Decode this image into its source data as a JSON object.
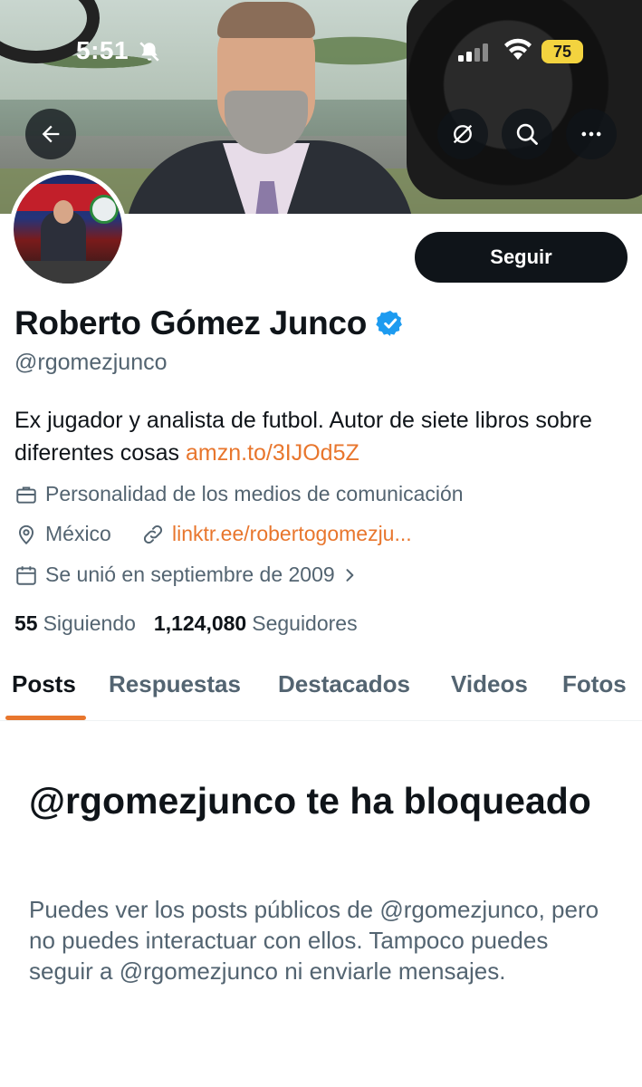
{
  "status_bar": {
    "time": "5:51",
    "battery": "75",
    "icons": [
      "bell-slash-icon",
      "signal-icon",
      "wifi-icon",
      "battery-icon"
    ]
  },
  "header": {
    "buttons": [
      "back-arrow-icon",
      "grok-icon",
      "search-icon",
      "more-icon"
    ]
  },
  "profile": {
    "name": "Roberto Gómez Junco",
    "handle": "@rgomezjunco",
    "follow_label": "Seguir",
    "bio_text": "Ex jugador y analista de futbol. Autor de siete libros sobre diferentes cosas ",
    "bio_link": "amzn.to/3IJOd5Z",
    "category": "Personalidad de los medios de comunicación",
    "location": "México",
    "website": "linktr.ee/robertogomezju...",
    "joined": "Se unió en septiembre de 2009",
    "following_count": "55",
    "following_label": "Siguiendo",
    "followers_count": "1,124,080",
    "followers_label": "Seguidores"
  },
  "tabs": [
    {
      "label": "Posts",
      "active": true
    },
    {
      "label": "Respuestas",
      "active": false
    },
    {
      "label": "Destacados",
      "active": false
    },
    {
      "label": "Videos",
      "active": false
    },
    {
      "label": "Fotos",
      "active": false
    }
  ],
  "blocked": {
    "title": "@rgomezjunco te ha bloqueado",
    "message": "Puedes ver los posts públicos de @rgomezjunco, pero no puedes interactuar con ellos. Tampoco puedes seguir a @rgomezjunco ni enviarle mensajes."
  },
  "colors": {
    "accent": "#e8762d",
    "verified": "#1d9bf0",
    "text_primary": "#0f1419",
    "text_secondary": "#536471",
    "battery": "#f3d33f"
  }
}
